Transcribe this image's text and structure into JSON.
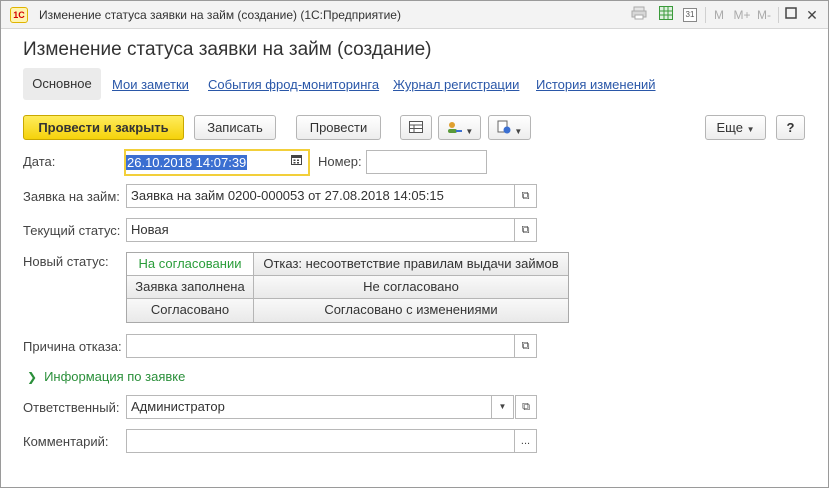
{
  "window": {
    "title": "Изменение статуса заявки на займ (создание)  (1С:Предприятие)",
    "logo_text": "1С",
    "toolbar_icons": [
      "print-icon",
      "spreadsheet-icon",
      "calendar-icon",
      "memory-m-icon",
      "memory-plus-icon",
      "memory-minus-icon",
      "minimize-icon",
      "close-icon"
    ],
    "tb_m": "M",
    "tb_mplus": "M+",
    "tb_mminus": "M-",
    "tb_cal": "31",
    "tb_close": "✕"
  },
  "form": {
    "title": "Изменение статуса заявки на займ (создание)"
  },
  "tabs": {
    "main": "Основное",
    "links": [
      "Мои заметки",
      "События фрод-мониторинга",
      "Журнал регистрации",
      "История изменений"
    ]
  },
  "toolbar": {
    "post_close": "Провести и закрыть",
    "save": "Записать",
    "post": "Провести",
    "more": "Еще",
    "help": "?"
  },
  "fields": {
    "date_label": "Дата:",
    "date_value": "26.10.2018 14:07:39",
    "number_label": "Номер:",
    "number_value": "",
    "loan_request_label": "Заявка на займ:",
    "loan_request_value": "Заявка на займ 0200-000053 от 27.08.2018 14:05:15",
    "current_status_label": "Текущий статус:",
    "current_status_value": "Новая",
    "new_status_label": "Новый статус:",
    "reject_reason_label": "Причина отказа:",
    "reject_reason_value": "",
    "responsible_label": "Ответственный:",
    "responsible_value": "Администратор",
    "comment_label": "Комментарий:",
    "comment_value": "",
    "comment_btn": "..."
  },
  "status_options": [
    {
      "label": "На согласовании",
      "selected": true
    },
    {
      "label": "Отказ: несоответствие правилам выдачи займов",
      "selected": false
    },
    {
      "label": "Заявка заполнена",
      "selected": false
    },
    {
      "label": "Не согласовано",
      "selected": false
    },
    {
      "label": "Согласовано",
      "selected": false
    },
    {
      "label": "Согласовано с изменениями",
      "selected": false
    }
  ],
  "section": {
    "loan_info": "Информация по заявке"
  },
  "colors": {
    "accent_yellow": "#f5d20b",
    "link_blue": "#2a57a8",
    "green": "#2a8f3a",
    "selection": "#3b6fd1"
  }
}
